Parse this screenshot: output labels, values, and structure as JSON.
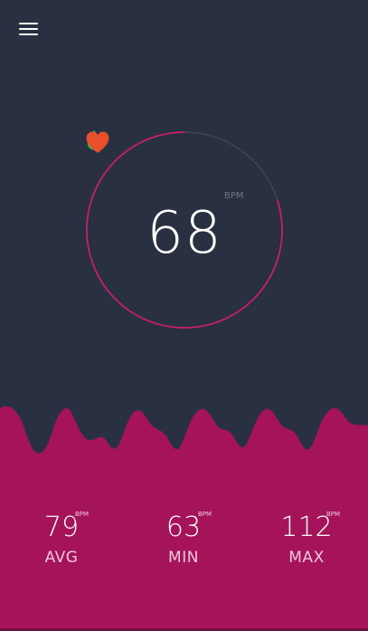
{
  "app": {
    "colors": {
      "background": "#283042",
      "accent": "#A5145A",
      "ring": "#C81E69",
      "ring_track": "#3E4658",
      "flame": "#2EB84A",
      "heart": "#E8502B"
    }
  },
  "header": {
    "menu_icon": "hamburger-menu-icon"
  },
  "gauge": {
    "bpm": "68",
    "unit": "BPM",
    "top_icon": "flame-icon",
    "bottom_icon": "heart-icon",
    "progress_percent": 80
  },
  "stats": [
    {
      "value": "79",
      "unit": "BPM",
      "label": "AVG"
    },
    {
      "value": "63",
      "unit": "BPM",
      "label": "MIN"
    },
    {
      "value": "112",
      "unit": "BPM",
      "label": "MAX"
    }
  ]
}
